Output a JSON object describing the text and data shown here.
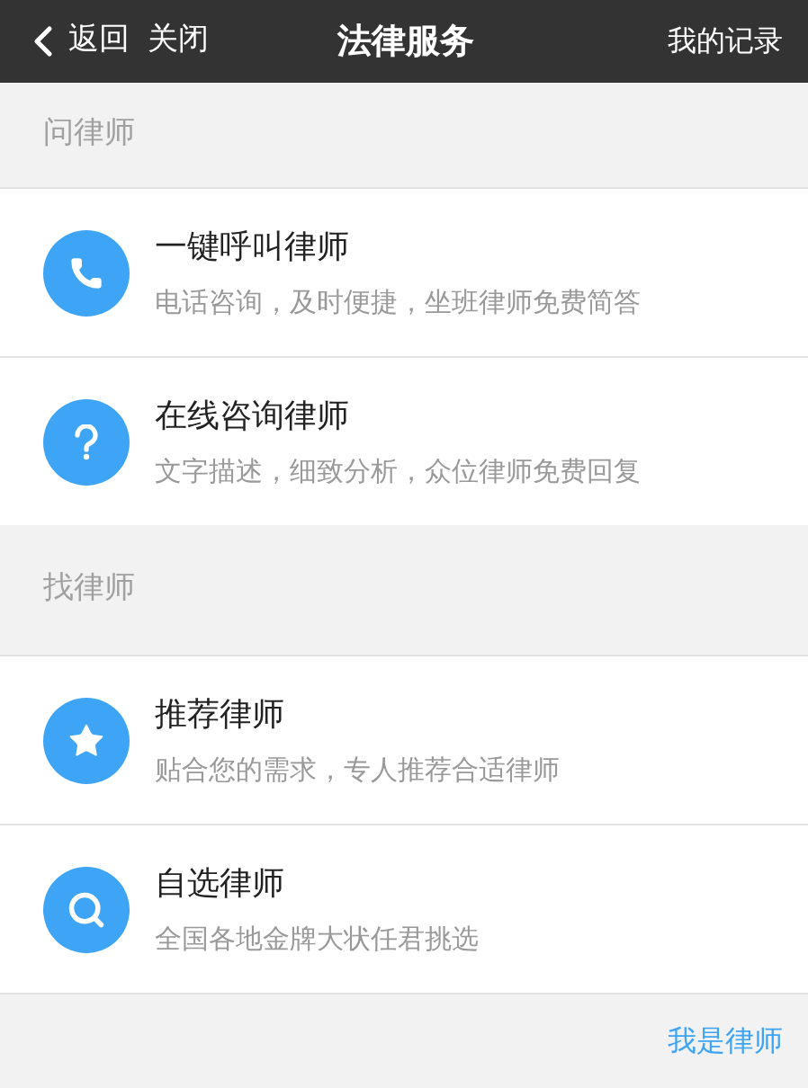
{
  "header": {
    "back": "返回",
    "close": "关闭",
    "title": "法律服务",
    "records": "我的记录"
  },
  "sections": [
    {
      "title": "问律师",
      "items": [
        {
          "kind": "phone",
          "title": "一键呼叫律师",
          "subtitle": "电话咨询，及时便捷，坐班律师免费简答"
        },
        {
          "kind": "question",
          "title": "在线咨询律师",
          "subtitle": "文字描述，细致分析，众位律师免费回复"
        }
      ]
    },
    {
      "title": "找律师",
      "items": [
        {
          "kind": "star",
          "title": "推荐律师",
          "subtitle": "贴合您的需求，专人推荐合适律师"
        },
        {
          "kind": "search",
          "title": "自选律师",
          "subtitle": "全国各地金牌大状任君挑选"
        }
      ]
    }
  ],
  "footer_link": "我是律师"
}
